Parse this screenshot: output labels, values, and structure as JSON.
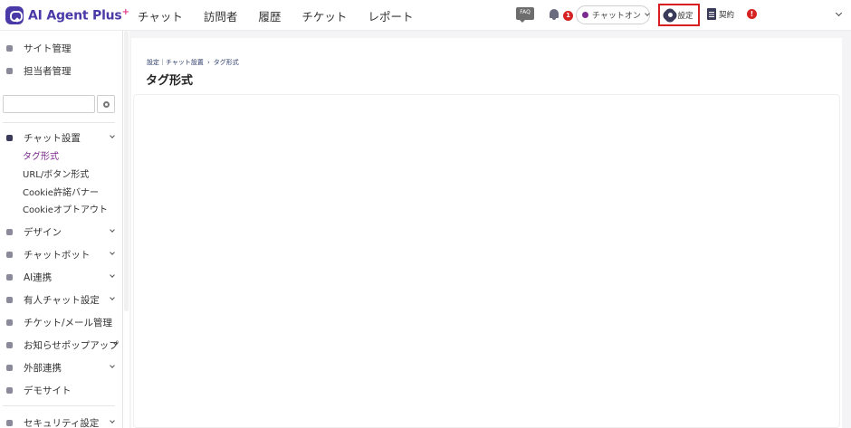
{
  "app": {
    "logo_text": "AI Agent Plus",
    "logo_plus": "+"
  },
  "nav": {
    "items": [
      "チャット",
      "訪問者",
      "履歴",
      "チケット",
      "レポート"
    ]
  },
  "header": {
    "faq_label": "FAQ",
    "notification_count": "1",
    "status_label": "チャットオン",
    "settings_label": "設定",
    "contract_label": "契約",
    "alert_label": "!"
  },
  "sidebar": {
    "top_items": [
      "サイト管理",
      "担当者管理"
    ],
    "search": {
      "value": "",
      "placeholder": ""
    },
    "chat_settings": {
      "label": "チャット設置",
      "sub_items": [
        "タグ形式",
        "URL/ボタン形式",
        "Cookie許諾バナー",
        "Cookieオプトアウト"
      ],
      "active_sub_item": "タグ形式"
    },
    "items": [
      "デザイン",
      "チャットボット",
      "AI連携",
      "有人チャット設定",
      "チケット/メール管理",
      "お知らせポップアップ",
      "外部連携",
      "デモサイト"
    ],
    "bottom_items": [
      "セキュリティ設定"
    ]
  },
  "main": {
    "breadcrumb": [
      "設定｜チャット設置",
      "›",
      "タグ形式"
    ],
    "page_title": "タグ形式"
  },
  "colors": {
    "brand": "#4a3aa8",
    "active_sub_item": "#7b2a8e",
    "highlight_border": "#d81e1e",
    "badge_red": "#d62222"
  }
}
